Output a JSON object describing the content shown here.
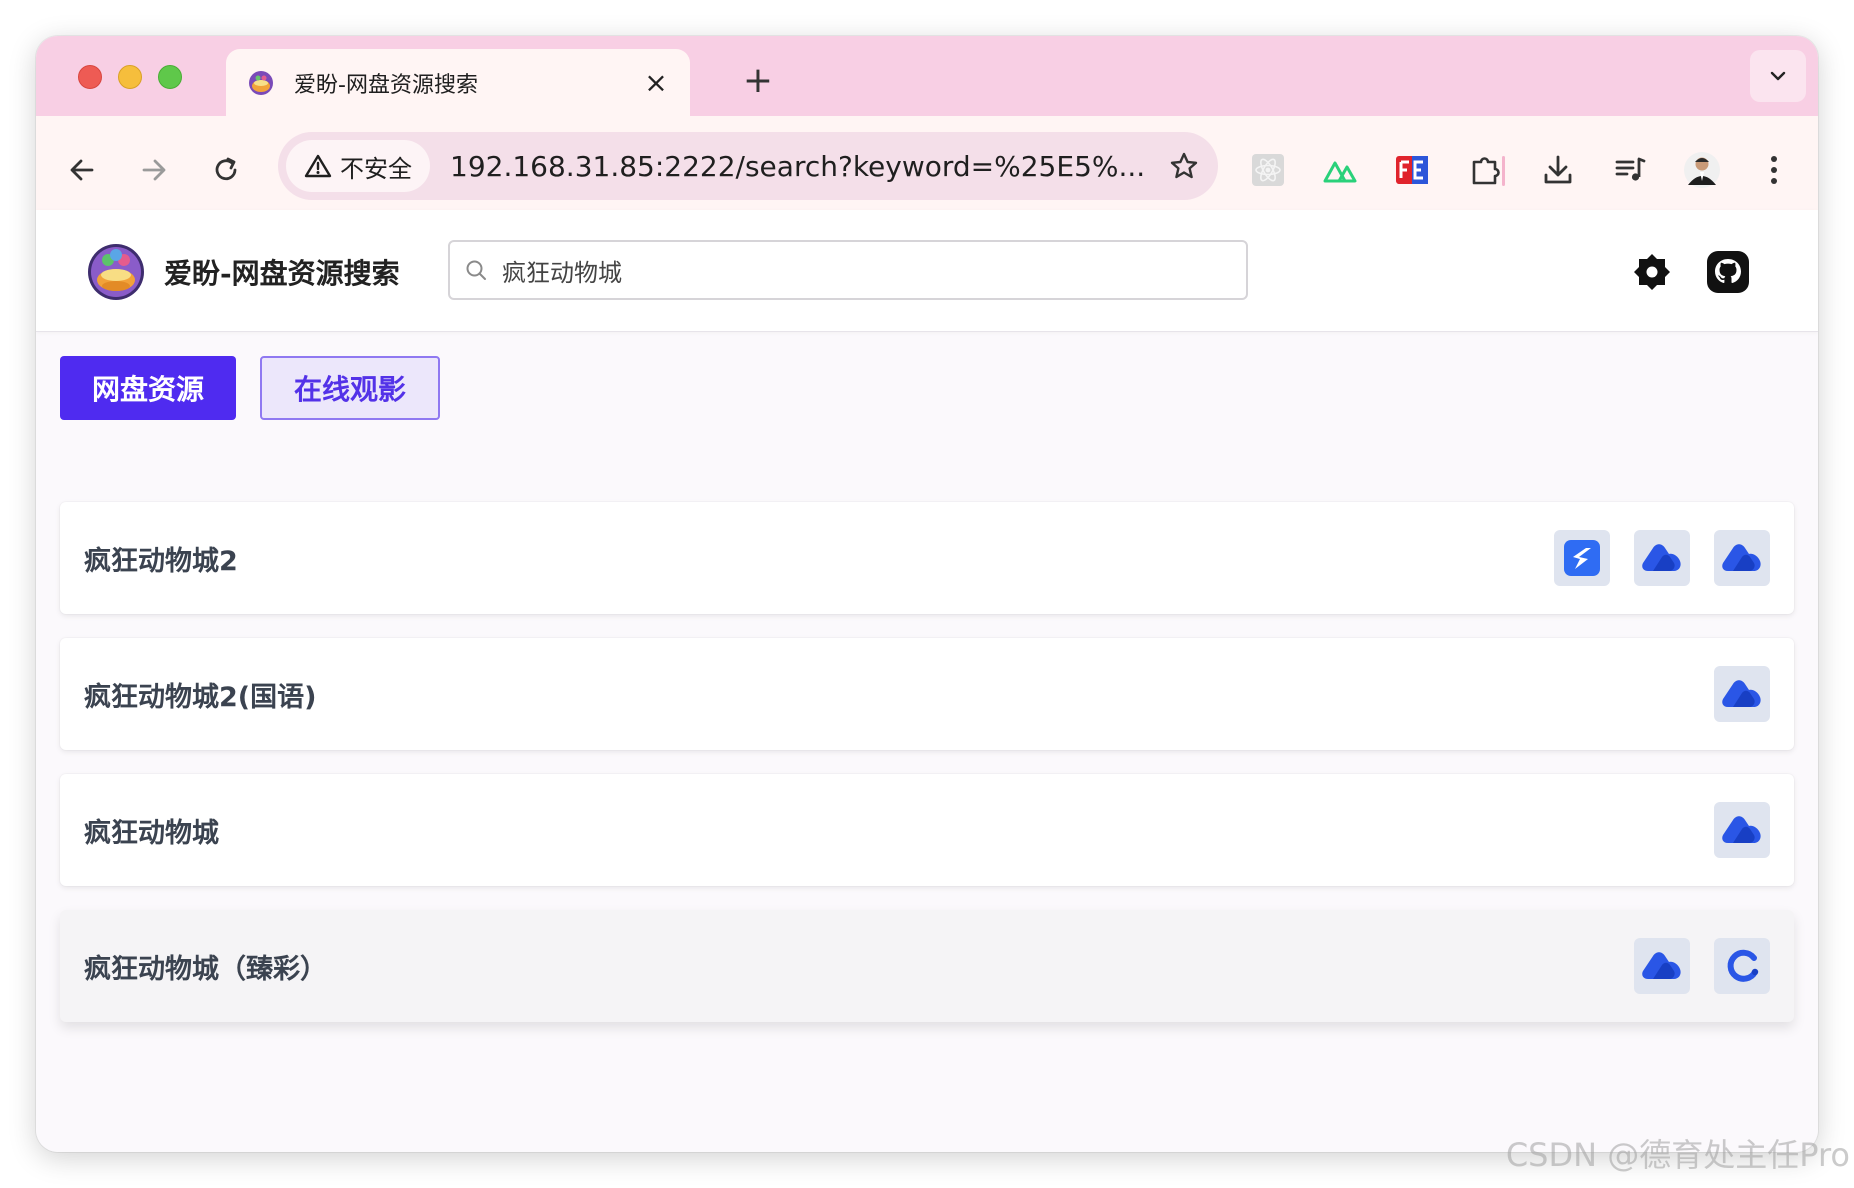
{
  "browser": {
    "tab": {
      "title": "爱盼-网盘资源搜索",
      "close": "×"
    },
    "new_tab": "+",
    "omnibox": {
      "security_label": "不安全",
      "url": "192.168.31.85:2222/search?keyword=%25E5%..."
    }
  },
  "site": {
    "title": "爱盼-网盘资源搜索",
    "search": {
      "value": "疯狂动物城"
    },
    "tabs": [
      {
        "label": "网盘资源",
        "active": true
      },
      {
        "label": "在线观影",
        "active": false
      }
    ],
    "results": [
      {
        "title": "疯狂动物城2",
        "sources": [
          "xunlei-icon",
          "cloud-drive-icon",
          "cloud-drive-icon"
        ]
      },
      {
        "title": "疯狂动物城2(国语)",
        "sources": [
          "cloud-drive-icon"
        ]
      },
      {
        "title": "疯狂动物城",
        "sources": [
          "cloud-drive-icon"
        ]
      },
      {
        "title": "疯狂动物城（臻彩）",
        "sources": [
          "cloud-drive-icon",
          "ring-drive-icon"
        ]
      }
    ]
  },
  "colors": {
    "tab_strip": "#f8cfe4",
    "toolbar": "#fff5f4",
    "primary": "#4f2bf0",
    "source_blue": "#2a56e6"
  },
  "watermark": "CSDN @德育处主任Pro"
}
